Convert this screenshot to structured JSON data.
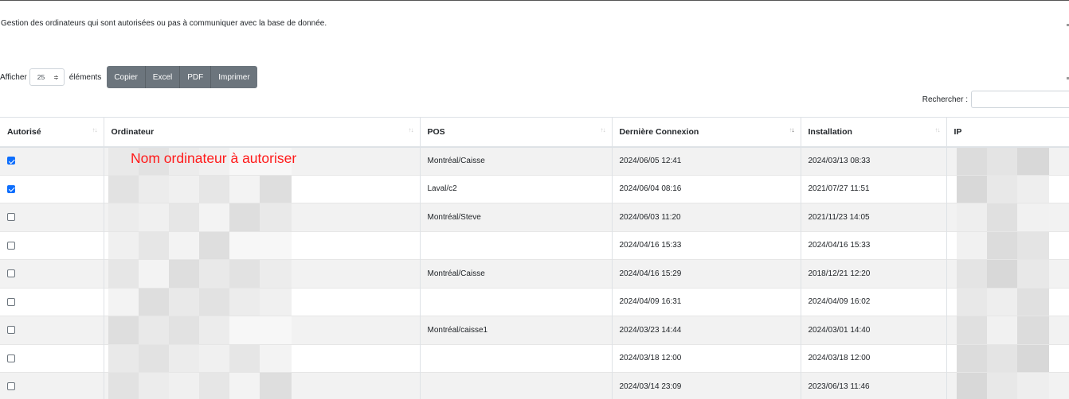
{
  "description": "Gestion des ordinateurs qui sont autorisées ou pas à communiquer avec la base de donnée.",
  "controls": {
    "show_label": "Afficher",
    "page_length": "25",
    "select_arrows": "≑",
    "entries_label": "éléments",
    "buttons": [
      "Copier",
      "Excel",
      "PDF",
      "Imprimer"
    ]
  },
  "search": {
    "label": "Rechercher :",
    "value": ""
  },
  "annotation": "Nom ordinateur à autoriser",
  "colors": {
    "accent": "#0d6efd",
    "button_bg": "#6c757d",
    "annotation": "#ff1a1a",
    "stripe": "#f2f2f2"
  },
  "table": {
    "headers": [
      "Autorisé",
      "Ordinateur",
      "POS",
      "Dernière Connexion",
      "Installation",
      "IP"
    ],
    "sort_icon": "↑↓",
    "sorted_column": "Dernière Connexion",
    "sort_direction": "descending",
    "rows": [
      {
        "authorized": true,
        "computer": "",
        "pos": "Montréal/Caisse",
        "last_connection": "2024/06/05 12:41",
        "installation": "2024/03/13 08:33",
        "ip": ""
      },
      {
        "authorized": true,
        "computer": "",
        "pos": "Laval/c2",
        "last_connection": "2024/06/04 08:16",
        "installation": "2021/07/27 11:51",
        "ip": ""
      },
      {
        "authorized": false,
        "computer": "",
        "pos": "Montréal/Steve",
        "last_connection": "2024/06/03 11:20",
        "installation": "2021/11/23 14:05",
        "ip": ""
      },
      {
        "authorized": false,
        "computer": "",
        "pos": "",
        "last_connection": "2024/04/16 15:33",
        "installation": "2024/04/16 15:33",
        "ip": ""
      },
      {
        "authorized": false,
        "computer": "",
        "pos": "Montréal/Caisse",
        "last_connection": "2024/04/16 15:29",
        "installation": "2018/12/21 12:20",
        "ip": ""
      },
      {
        "authorized": false,
        "computer": "",
        "pos": "",
        "last_connection": "2024/04/09 16:31",
        "installation": "2024/04/09 16:02",
        "ip": ""
      },
      {
        "authorized": false,
        "computer": "",
        "pos": "Montréal/caisse1",
        "last_connection": "2024/03/23 14:44",
        "installation": "2024/03/01 14:40",
        "ip": ""
      },
      {
        "authorized": false,
        "computer": "",
        "pos": "",
        "last_connection": "2024/03/18 12:00",
        "installation": "2024/03/18 12:00",
        "ip": ""
      },
      {
        "authorized": false,
        "computer": "",
        "pos": "",
        "last_connection": "2024/03/14 23:09",
        "installation": "2023/06/13 11:46",
        "ip": ""
      }
    ]
  }
}
